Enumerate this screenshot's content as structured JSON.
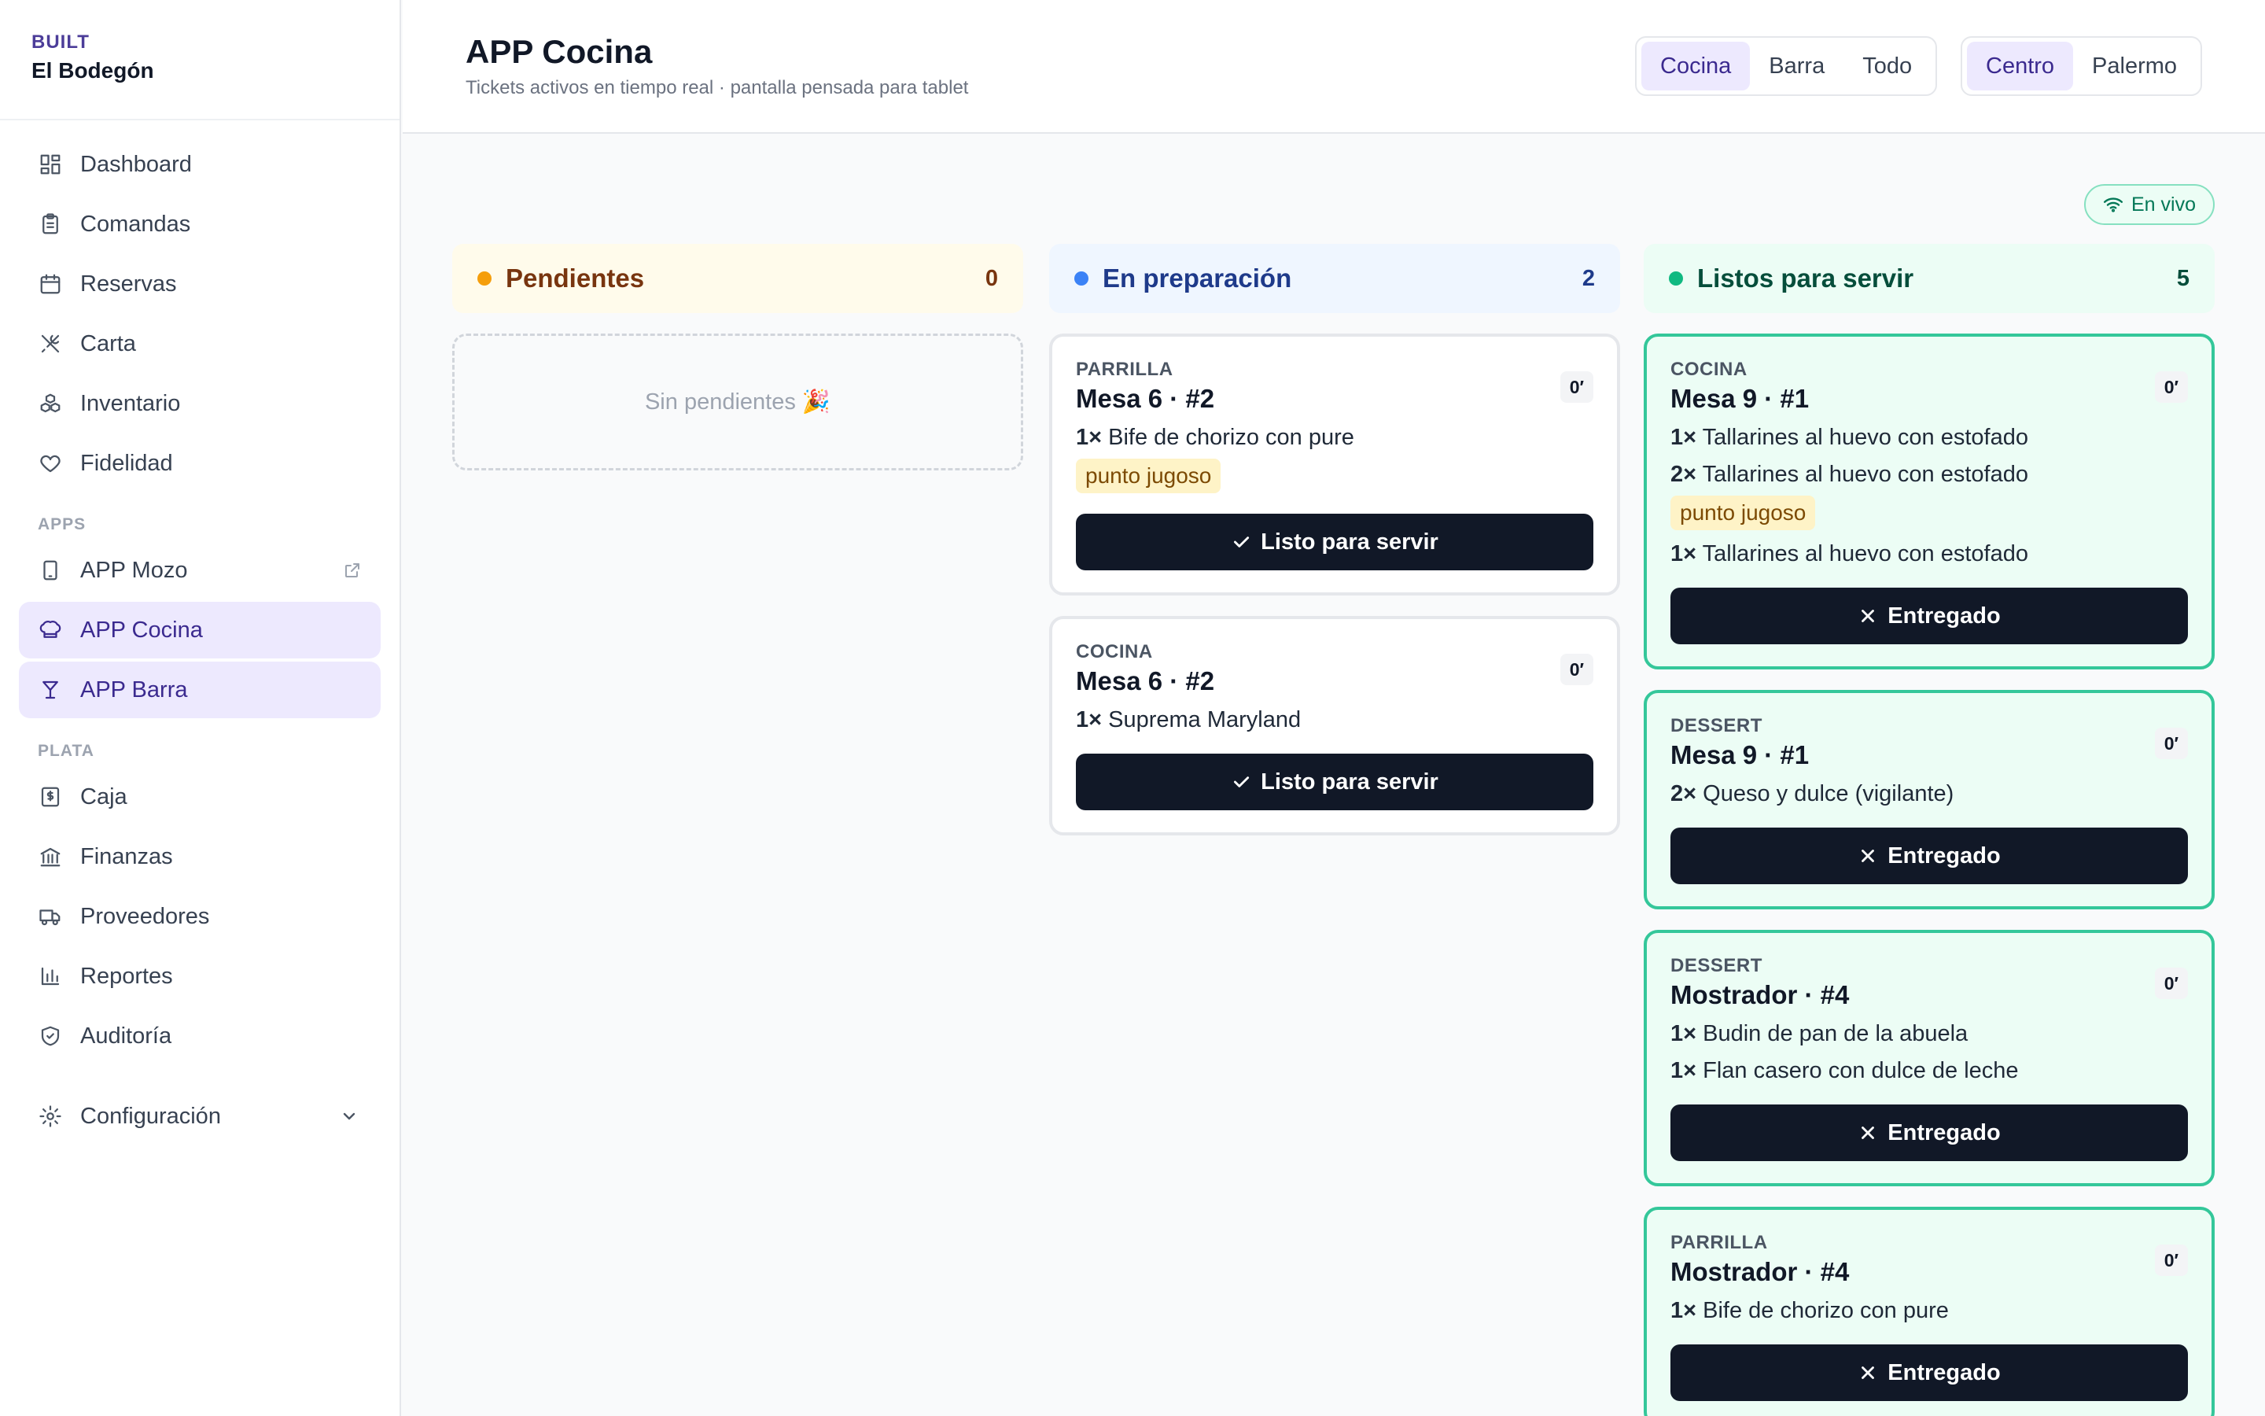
{
  "sidebar": {
    "brand_small": "BUILT",
    "brand_name": "El Bodegón",
    "items": [
      {
        "label": "Dashboard",
        "icon": "dashboard-icon"
      },
      {
        "label": "Comandas",
        "icon": "clipboard-icon"
      },
      {
        "label": "Reservas",
        "icon": "calendar-icon"
      },
      {
        "label": "Carta",
        "icon": "utensils-icon"
      },
      {
        "label": "Inventario",
        "icon": "boxes-icon"
      },
      {
        "label": "Fidelidad",
        "icon": "heart-icon"
      }
    ],
    "section_apps": "APPS",
    "apps": [
      {
        "label": "APP Mozo",
        "icon": "tablet-icon",
        "external": true
      },
      {
        "label": "APP Cocina",
        "icon": "chef-hat-icon",
        "active": true
      },
      {
        "label": "APP Barra",
        "icon": "cocktail-icon",
        "active": true
      }
    ],
    "section_plata": "PLATA",
    "plata": [
      {
        "label": "Caja",
        "icon": "cash-register-icon"
      },
      {
        "label": "Finanzas",
        "icon": "bank-icon"
      },
      {
        "label": "Proveedores",
        "icon": "truck-icon"
      },
      {
        "label": "Reportes",
        "icon": "bar-chart-icon"
      },
      {
        "label": "Auditoría",
        "icon": "shield-check-icon"
      }
    ],
    "settings": {
      "label": "Configuración",
      "icon": "gear-icon"
    }
  },
  "header": {
    "title": "APP Cocina",
    "subtitle": "Tickets activos en tiempo real · pantalla pensada para tablet",
    "station_filter": [
      {
        "label": "Cocina",
        "active": true
      },
      {
        "label": "Barra"
      },
      {
        "label": "Todo"
      }
    ],
    "branch_filter": [
      {
        "label": "Centro",
        "active": true
      },
      {
        "label": "Palermo"
      }
    ]
  },
  "live_badge": "En vivo",
  "columns": {
    "pending": {
      "title": "Pendientes",
      "count": "0",
      "empty": "Sin pendientes 🎉",
      "color": "#f59e0b",
      "bg": "#fffbeb",
      "text_color": "#78350f"
    },
    "preparing": {
      "title": "En preparación",
      "count": "2",
      "color": "#3b82f6",
      "bg": "#eff6ff",
      "text_color": "#1e3a8a",
      "tickets": [
        {
          "station": "PARRILLA",
          "table": "Mesa 6 · #2",
          "time": "0′",
          "lines": [
            {
              "qty": "1×",
              "name": "Bife de chorizo con pure",
              "note": "punto jugoso"
            }
          ],
          "action": "Listo para servir"
        },
        {
          "station": "COCINA",
          "table": "Mesa 6 · #2",
          "time": "0′",
          "lines": [
            {
              "qty": "1×",
              "name": "Suprema Maryland"
            }
          ],
          "action": "Listo para servir"
        }
      ]
    },
    "ready": {
      "title": "Listos para servir",
      "count": "5",
      "color": "#10b981",
      "bg": "#ecfdf5",
      "text_color": "#064e3b",
      "tickets": [
        {
          "station": "COCINA",
          "table": "Mesa 9 · #1",
          "time": "0′",
          "lines": [
            {
              "qty": "1×",
              "name": "Tallarines al huevo con estofado"
            },
            {
              "qty": "2×",
              "name": "Tallarines al huevo con estofado",
              "note": "punto jugoso"
            },
            {
              "qty": "1×",
              "name": "Tallarines al huevo con estofado"
            }
          ],
          "action": "Entregado"
        },
        {
          "station": "DESSERT",
          "table": "Mesa 9 · #1",
          "time": "0′",
          "lines": [
            {
              "qty": "2×",
              "name": "Queso y dulce (vigilante)"
            }
          ],
          "action": "Entregado"
        },
        {
          "station": "DESSERT",
          "table": "Mostrador · #4",
          "time": "0′",
          "lines": [
            {
              "qty": "1×",
              "name": "Budin de pan de la abuela"
            },
            {
              "qty": "1×",
              "name": "Flan casero con dulce de leche"
            }
          ],
          "action": "Entregado"
        },
        {
          "station": "PARRILLA",
          "table": "Mostrador · #4",
          "time": "0′",
          "lines": [
            {
              "qty": "1×",
              "name": "Bife de chorizo con pure"
            }
          ],
          "action": "Entregado"
        }
      ]
    }
  }
}
